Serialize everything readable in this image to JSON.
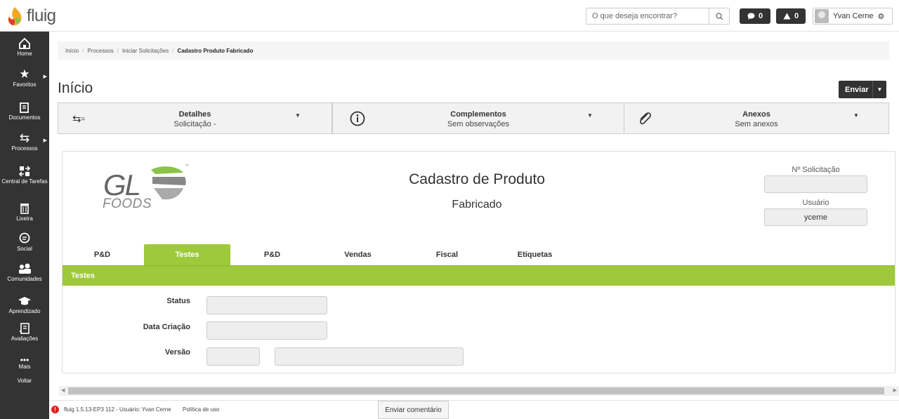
{
  "header": {
    "logo_text": "fluig",
    "search_placeholder": "O que deseja encontrar?",
    "messages_count": "0",
    "alerts_count": "0",
    "user_name": "Yvan Cerne"
  },
  "sidebar": {
    "items": [
      {
        "label": "Home",
        "icon": "home-icon"
      },
      {
        "label": "Favoritos",
        "icon": "star-icon"
      },
      {
        "label": "Documentos",
        "icon": "documents-icon"
      },
      {
        "label": "Processos",
        "icon": "processes-icon"
      },
      {
        "label": "Central de Tarefas",
        "icon": "tasks-icon"
      },
      {
        "label": "Lixeira",
        "icon": "trash-icon"
      },
      {
        "label": "Social",
        "icon": "social-icon"
      },
      {
        "label": "Comunidades",
        "icon": "communities-icon"
      },
      {
        "label": "Aprendizado",
        "icon": "learning-icon"
      },
      {
        "label": "Avaliações",
        "icon": "evaluations-icon"
      },
      {
        "label": "Mais",
        "icon": "more-icon"
      },
      {
        "label": "Voltar",
        "icon": ""
      }
    ]
  },
  "breadcrumb": {
    "items": [
      "Início",
      "Processos",
      "Iniciar Solicitações"
    ],
    "current": "Cadastro Produto Fabricado"
  },
  "page": {
    "title": "Início",
    "send_label": "Enviar"
  },
  "info_tabs": [
    {
      "title": "Detalhes",
      "subtitle": "Solicitação -",
      "icon": "process-flow-icon"
    },
    {
      "title": "Complementos",
      "subtitle": "Sem observações",
      "icon": "info-icon"
    },
    {
      "title": "Anexos",
      "subtitle": "Sem anexos",
      "icon": "paperclip-icon"
    }
  ],
  "form": {
    "logo_text": "GL",
    "logo_sub": "FOODS",
    "title": "Cadastro de Produto",
    "subtitle": "Fabricado",
    "request_number_label": "Nº Solicitação",
    "request_number_value": "",
    "user_label": "Usuário",
    "user_value": "ycerne",
    "tabs": [
      "P&D",
      "Testes",
      "P&D",
      "Vendas",
      "Fiscal",
      "Etiquetas"
    ],
    "active_tab_index": 1,
    "section_title": "Testes",
    "fields": {
      "status_label": "Status",
      "status_value": "",
      "creation_date_label": "Data Criação",
      "creation_date_value": "",
      "version_label": "Versão",
      "version_value": "",
      "version_desc_value": ""
    }
  },
  "footer": {
    "version_text": "fluig 1.5.13-EP3 112 - Usuário: Yvan Cerne",
    "policy_link": "Política de uso",
    "comment_button": "Enviar comentário"
  },
  "colors": {
    "accent_green": "#9dc93b",
    "sidebar_bg": "#333333",
    "alert_red": "#e02020"
  }
}
